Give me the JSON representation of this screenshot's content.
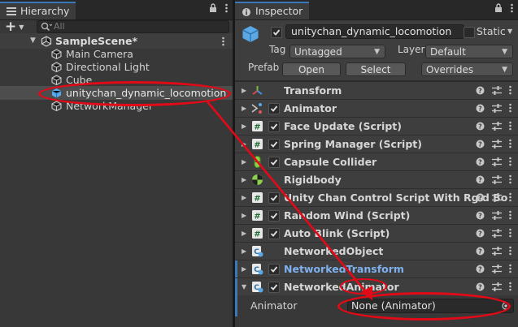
{
  "hierarchy": {
    "tab_label": "Hierarchy",
    "search_placeholder": "All",
    "add_label": "+",
    "scene_name": "SampleScene*",
    "items": [
      {
        "label": "Main Camera"
      },
      {
        "label": "Directional Light"
      },
      {
        "label": "Cube"
      },
      {
        "label": "unitychan_dynamic_locomotion"
      },
      {
        "label": "NetworkManager"
      }
    ]
  },
  "inspector": {
    "tab_label": "Inspector",
    "object_name": "unitychan_dynamic_locomotion",
    "static_label": "Static",
    "tag_label": "Tag",
    "tag_value": "Untagged",
    "layer_label": "Layer",
    "layer_value": "Default",
    "prefab_label": "Prefab",
    "open_label": "Open",
    "select_label": "Select",
    "overrides_label": "Overrides",
    "components": [
      {
        "name": "Transform",
        "icon": "transform-icon",
        "checkbox": false
      },
      {
        "name": "Animator",
        "icon": "animator-icon",
        "checkbox": true
      },
      {
        "name": "Face Update (Script)",
        "icon": "script-icon",
        "checkbox": true
      },
      {
        "name": "Spring Manager (Script)",
        "icon": "script-icon",
        "checkbox": true
      },
      {
        "name": "Capsule Collider",
        "icon": "capsule-collider-icon",
        "checkbox": true
      },
      {
        "name": "Rigidbody",
        "icon": "rigidbody-icon",
        "checkbox": false
      },
      {
        "name": "Unity Chan Control Script With Rgid Bo",
        "icon": "script-icon",
        "checkbox": true
      },
      {
        "name": "Random Wind (Script)",
        "icon": "script-icon",
        "checkbox": true
      },
      {
        "name": "Auto Blink (Script)",
        "icon": "script-icon",
        "checkbox": true
      },
      {
        "name": "NetworkedObject",
        "icon": "networked-script-icon",
        "checkbox": false
      },
      {
        "name": "NetworkedTransform",
        "icon": "networked-script-icon",
        "checkbox": true
      },
      {
        "name": "NetworkedAnimator",
        "icon": "networked-script-icon",
        "checkbox": true
      }
    ],
    "animator_field_label": "Animator",
    "animator_field_value": "None (Animator)"
  },
  "colors": {
    "accent": "#3a79bb",
    "annotation": "#e20a17",
    "highlight_text": "#7fb1ee"
  }
}
